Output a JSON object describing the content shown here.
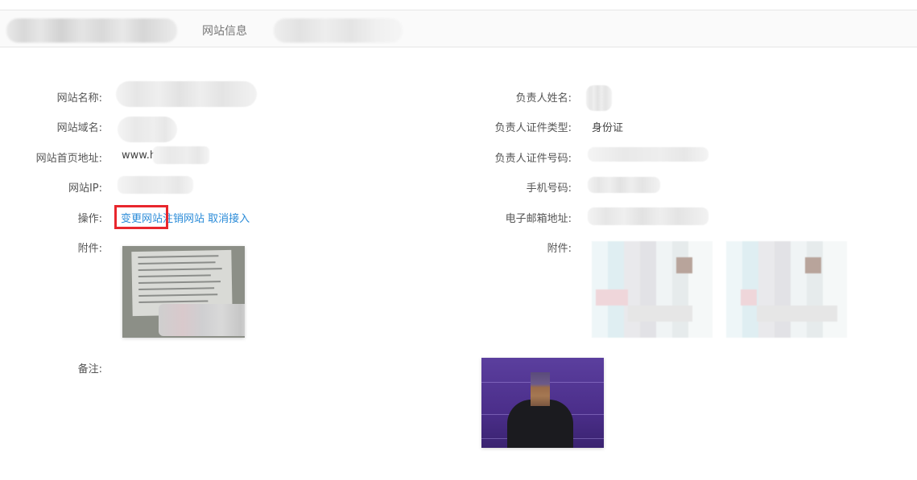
{
  "tabs": {
    "active_label": "网站信息"
  },
  "left": {
    "site_name_label": "网站名称:",
    "site_domain_label": "网站域名:",
    "home_url_label": "网站首页地址:",
    "home_url_value": "www.h",
    "site_ip_label": "网站IP:",
    "operations_label": "操作:",
    "operations": {
      "change_site": "变更网站",
      "cancel_site": "注销网站",
      "cancel_access": "取消接入"
    },
    "attachment_label": "附件:",
    "remarks_label": "备注:"
  },
  "right": {
    "owner_name_label": "负责人姓名:",
    "owner_id_type_label": "负责人证件类型:",
    "owner_id_type_value": "身份证",
    "owner_id_number_label": "负责人证件号码:",
    "mobile_label": "手机号码:",
    "email_label": "电子邮箱地址:",
    "attachment_label": "附件:"
  },
  "colors": {
    "link": "#2a8bd8",
    "highlight": "#e8262d"
  },
  "icons": []
}
